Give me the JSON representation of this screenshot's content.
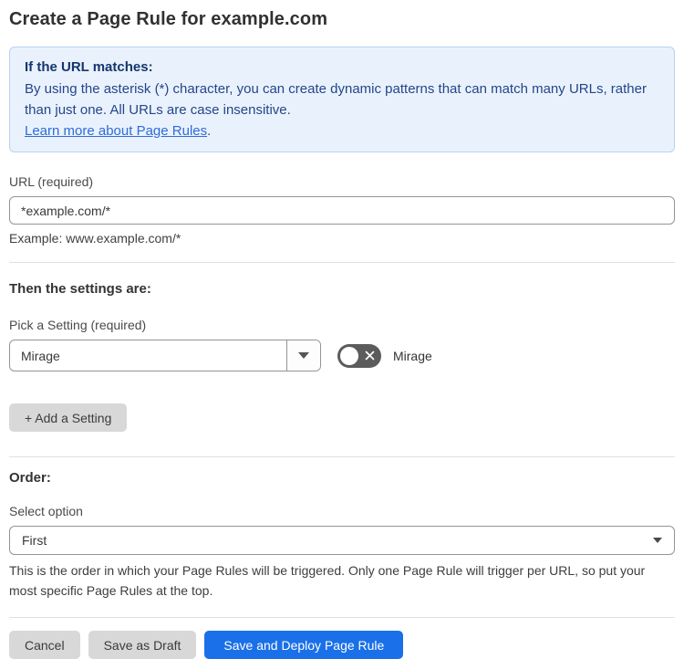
{
  "page": {
    "title": "Create a Page Rule for example.com"
  },
  "info_box": {
    "heading": "If the URL matches:",
    "body": "By using the asterisk (*) character, you can create dynamic patterns that can match many URLs, rather than just one. All URLs are case insensitive.",
    "link_text": "Learn more about Page Rules",
    "link_suffix": "."
  },
  "url_field": {
    "label": "URL (required)",
    "value": "*example.com/*",
    "example": "Example: www.example.com/*"
  },
  "settings_section": {
    "heading": "Then the settings are:",
    "picker_label": "Pick a Setting (required)",
    "picker_value": "Mirage",
    "toggle_label": "Mirage",
    "toggle_state": "off",
    "add_button_label": "+ Add a Setting"
  },
  "order_section": {
    "heading": "Order:",
    "select_label": "Select option",
    "select_value": "First",
    "help_text": "This is the order in which your Page Rules will be triggered. Only one Page Rule will trigger per URL, so put your most specific Page Rules at the top."
  },
  "actions": {
    "cancel_label": "Cancel",
    "save_draft_label": "Save as Draft",
    "save_deploy_label": "Save and Deploy Page Rule"
  },
  "colors": {
    "accent_blue": "#1a70e8",
    "info_background": "#e9f2fc",
    "info_border": "#b7d3f1",
    "info_text": "#25458a",
    "link_blue": "#2f6bd8",
    "toggle_off_gray": "#5c5c5c"
  }
}
